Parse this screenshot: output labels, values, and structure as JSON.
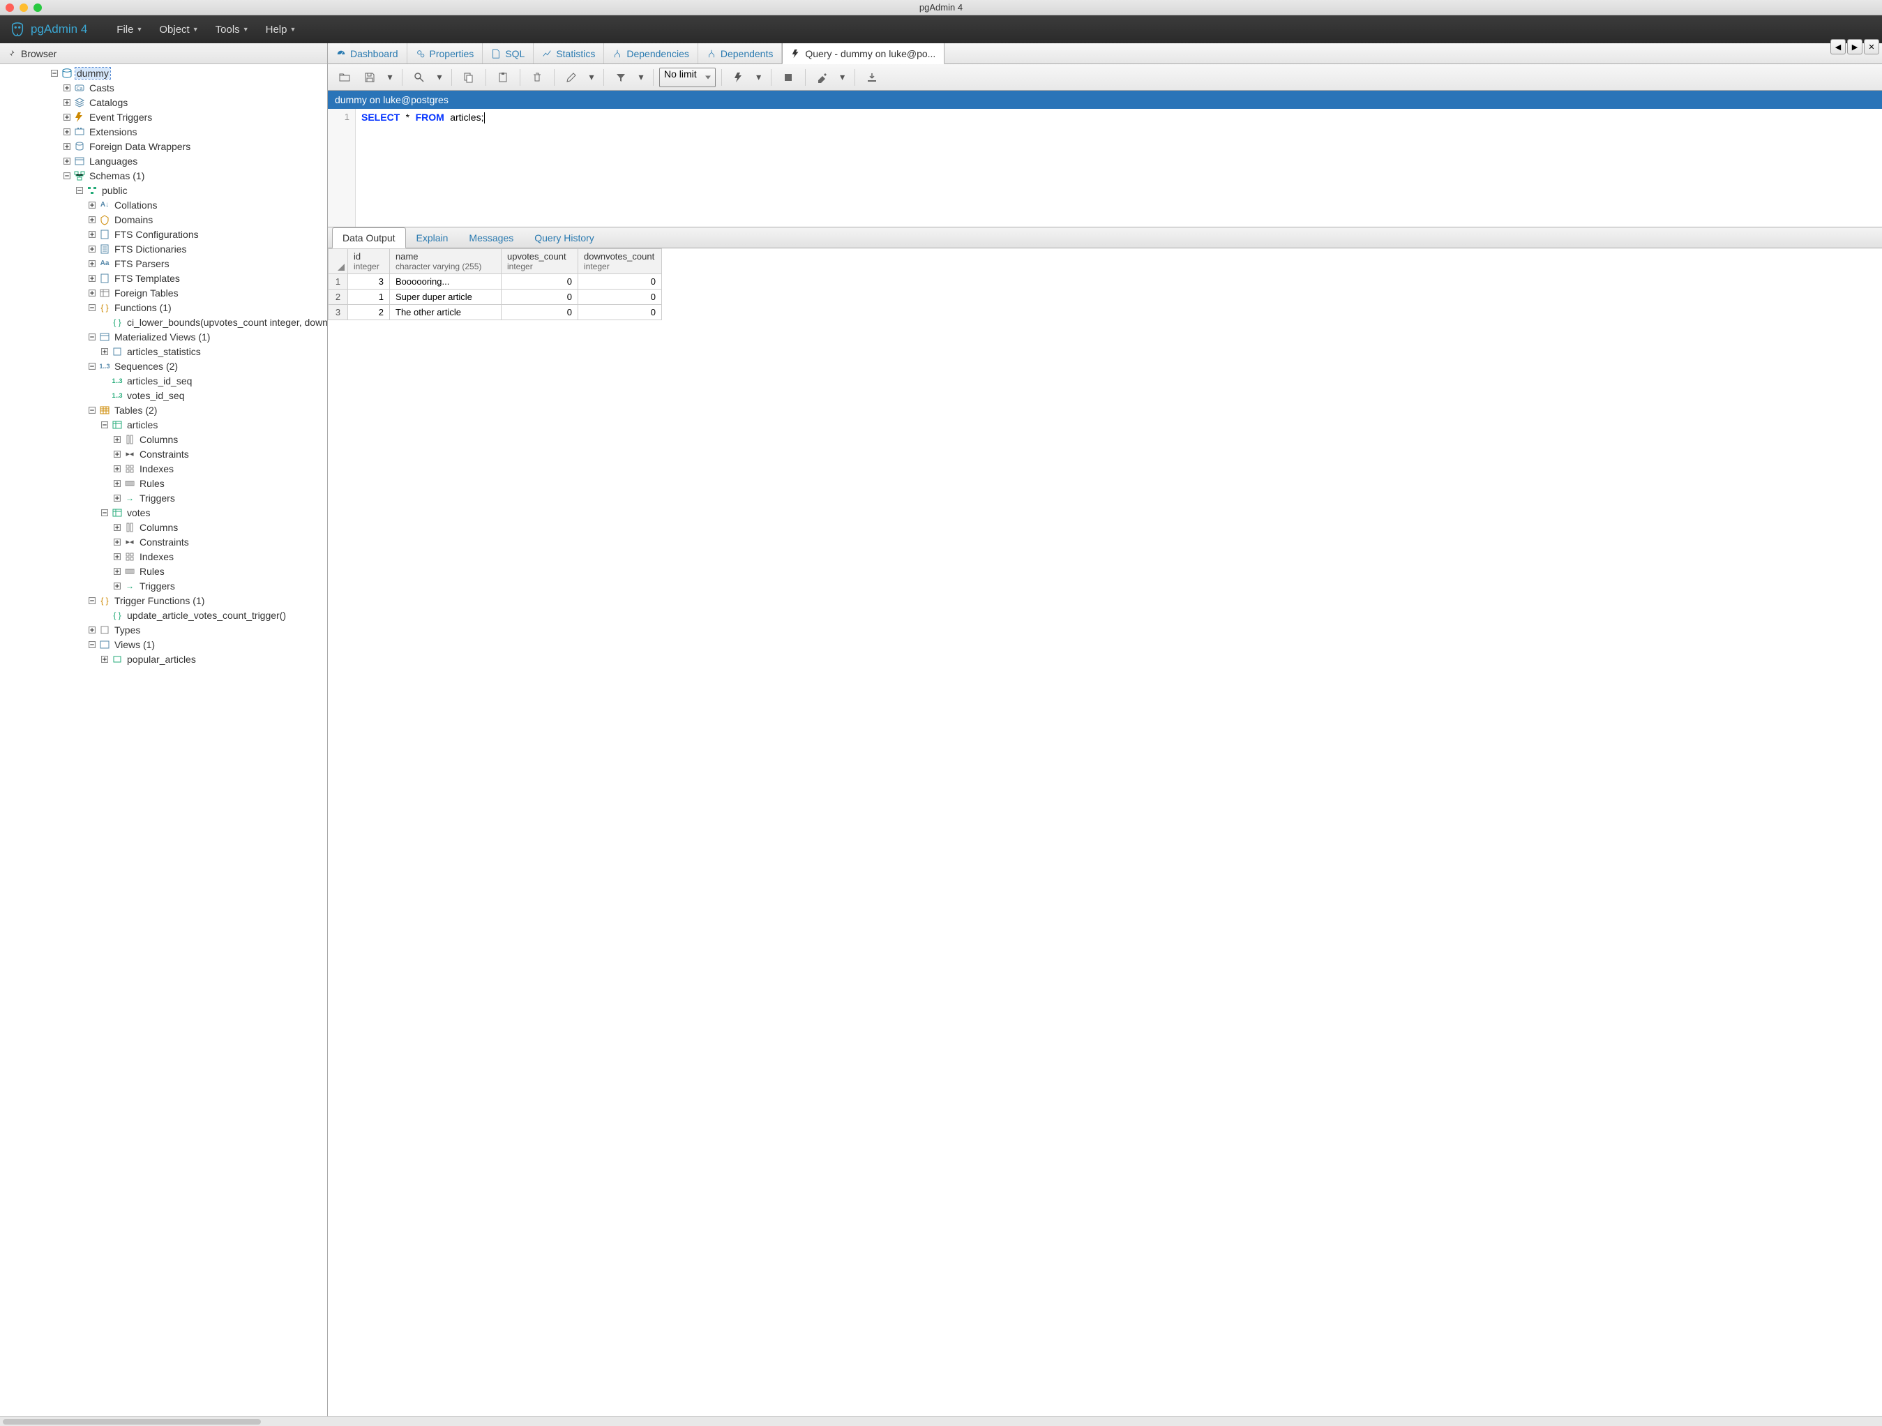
{
  "window_title": "pgAdmin 4",
  "brand": "pgAdmin 4",
  "menus": [
    "File",
    "Object",
    "Tools",
    "Help"
  ],
  "browser_header": "Browser",
  "tabs": [
    {
      "label": "Dashboard",
      "icon": "dashboard"
    },
    {
      "label": "Properties",
      "icon": "gears"
    },
    {
      "label": "SQL",
      "icon": "file"
    },
    {
      "label": "Statistics",
      "icon": "chart"
    },
    {
      "label": "Dependencies",
      "icon": "dep"
    },
    {
      "label": "Dependents",
      "icon": "dep"
    },
    {
      "label": "Query - dummy on luke@po...",
      "icon": "bolt",
      "active": true
    }
  ],
  "limit_label": "No limit",
  "connection_label": "dummy on luke@postgres",
  "sql_line_number": "1",
  "sql": {
    "k1": "SELECT",
    "star": "*",
    "k2": "FROM",
    "ident": "articles",
    "semi": ";"
  },
  "result_tabs": [
    "Data Output",
    "Explain",
    "Messages",
    "Query History"
  ],
  "result_active": 0,
  "columns": [
    {
      "name": "id",
      "type": "integer"
    },
    {
      "name": "name",
      "type": "character varying (255)"
    },
    {
      "name": "upvotes_count",
      "type": "integer"
    },
    {
      "name": "downvotes_count",
      "type": "integer"
    }
  ],
  "rows": [
    {
      "n": "1",
      "id": "3",
      "name": "Boooooring...",
      "up": "0",
      "down": "0"
    },
    {
      "n": "2",
      "id": "1",
      "name": "Super duper article",
      "up": "0",
      "down": "0"
    },
    {
      "n": "3",
      "id": "2",
      "name": "The other article",
      "up": "0",
      "down": "0"
    }
  ],
  "tree": [
    {
      "d": 4,
      "t": "minus",
      "icon": "db",
      "label": "dummy",
      "sel": true
    },
    {
      "d": 5,
      "t": "plus",
      "icon": "cast",
      "label": "Casts"
    },
    {
      "d": 5,
      "t": "plus",
      "icon": "catalog",
      "label": "Catalogs"
    },
    {
      "d": 5,
      "t": "plus",
      "icon": "bolt",
      "label": "Event Triggers"
    },
    {
      "d": 5,
      "t": "plus",
      "icon": "ext",
      "label": "Extensions"
    },
    {
      "d": 5,
      "t": "plus",
      "icon": "fdw",
      "label": "Foreign Data Wrappers"
    },
    {
      "d": 5,
      "t": "plus",
      "icon": "lang",
      "label": "Languages"
    },
    {
      "d": 5,
      "t": "minus",
      "icon": "schema",
      "label": "Schemas (1)"
    },
    {
      "d": 6,
      "t": "minus",
      "icon": "schema-pub",
      "label": "public"
    },
    {
      "d": 7,
      "t": "plus",
      "icon": "coll",
      "label": "Collations"
    },
    {
      "d": 7,
      "t": "plus",
      "icon": "domain",
      "label": "Domains"
    },
    {
      "d": 7,
      "t": "plus",
      "icon": "ftsc",
      "label": "FTS Configurations"
    },
    {
      "d": 7,
      "t": "plus",
      "icon": "ftsd",
      "label": "FTS Dictionaries"
    },
    {
      "d": 7,
      "t": "plus",
      "icon": "ftsp",
      "label": "FTS Parsers"
    },
    {
      "d": 7,
      "t": "plus",
      "icon": "ftst",
      "label": "FTS Templates"
    },
    {
      "d": 7,
      "t": "plus",
      "icon": "ftable",
      "label": "Foreign Tables"
    },
    {
      "d": 7,
      "t": "minus",
      "icon": "func",
      "label": "Functions (1)"
    },
    {
      "d": 8,
      "t": "",
      "icon": "func1",
      "label": "ci_lower_bounds(upvotes_count integer, downvotes_co"
    },
    {
      "d": 7,
      "t": "minus",
      "icon": "mview",
      "label": "Materialized Views (1)"
    },
    {
      "d": 8,
      "t": "plus",
      "icon": "mview1",
      "label": "articles_statistics"
    },
    {
      "d": 7,
      "t": "minus",
      "icon": "seq",
      "label": "Sequences (2)"
    },
    {
      "d": 8,
      "t": "",
      "icon": "seq1",
      "label": "articles_id_seq"
    },
    {
      "d": 8,
      "t": "",
      "icon": "seq1",
      "label": "votes_id_seq"
    },
    {
      "d": 7,
      "t": "minus",
      "icon": "tables",
      "label": "Tables (2)"
    },
    {
      "d": 8,
      "t": "minus",
      "icon": "table",
      "label": "articles"
    },
    {
      "d": 9,
      "t": "plus",
      "icon": "cols",
      "label": "Columns"
    },
    {
      "d": 9,
      "t": "plus",
      "icon": "cons",
      "label": "Constraints"
    },
    {
      "d": 9,
      "t": "plus",
      "icon": "idx",
      "label": "Indexes"
    },
    {
      "d": 9,
      "t": "plus",
      "icon": "rule",
      "label": "Rules"
    },
    {
      "d": 9,
      "t": "plus",
      "icon": "trig",
      "label": "Triggers"
    },
    {
      "d": 8,
      "t": "minus",
      "icon": "table",
      "label": "votes"
    },
    {
      "d": 9,
      "t": "plus",
      "icon": "cols",
      "label": "Columns"
    },
    {
      "d": 9,
      "t": "plus",
      "icon": "cons",
      "label": "Constraints"
    },
    {
      "d": 9,
      "t": "plus",
      "icon": "idx",
      "label": "Indexes"
    },
    {
      "d": 9,
      "t": "plus",
      "icon": "rule",
      "label": "Rules"
    },
    {
      "d": 9,
      "t": "plus",
      "icon": "trig",
      "label": "Triggers"
    },
    {
      "d": 7,
      "t": "minus",
      "icon": "tfunc",
      "label": "Trigger Functions (1)"
    },
    {
      "d": 8,
      "t": "",
      "icon": "func1",
      "label": "update_article_votes_count_trigger()"
    },
    {
      "d": 7,
      "t": "plus",
      "icon": "type",
      "label": "Types"
    },
    {
      "d": 7,
      "t": "minus",
      "icon": "view",
      "label": "Views (1)"
    },
    {
      "d": 8,
      "t": "plus",
      "icon": "view1",
      "label": "popular_articles"
    }
  ]
}
